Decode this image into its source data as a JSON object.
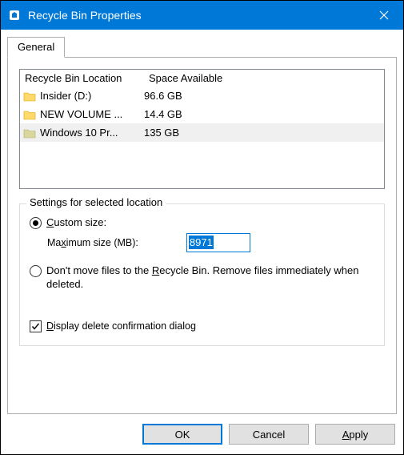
{
  "titlebar": {
    "title": "Recycle Bin Properties"
  },
  "tab": {
    "label": "General"
  },
  "list": {
    "header_location": "Recycle Bin Location",
    "header_space": "Space Available",
    "rows": [
      {
        "name": "Insider (D:)",
        "space": "96.6 GB"
      },
      {
        "name": "NEW VOLUME ...",
        "space": "14.4 GB"
      },
      {
        "name": "Windows 10 Pr...",
        "space": "135 GB"
      }
    ]
  },
  "settings": {
    "group_label": "Settings for selected location",
    "custom_size_label": "Custom size:",
    "max_size_label": "Maximum size (MB):",
    "max_size_value": "8971",
    "dont_move_label": "Don't move files to the Recycle Bin. Remove files immediately when deleted.",
    "display_confirm_label": "Display delete confirmation dialog"
  },
  "buttons": {
    "ok": "OK",
    "cancel": "Cancel",
    "apply": "Apply"
  }
}
